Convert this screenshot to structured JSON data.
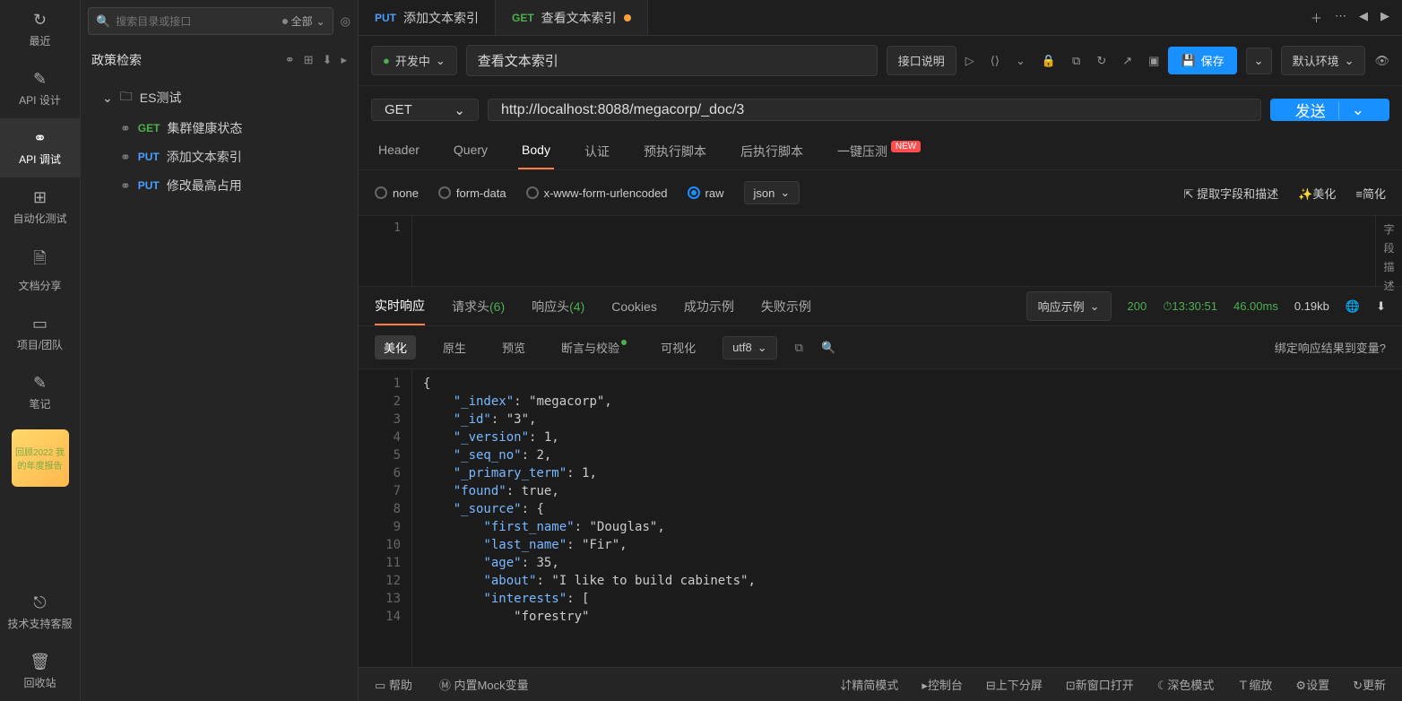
{
  "leftbar": {
    "items": [
      {
        "label": "最近",
        "icon": "↻"
      },
      {
        "label": "API 设计",
        "icon": "✎"
      },
      {
        "label": "API 调试",
        "icon": "⚭"
      },
      {
        "label": "自动化测试",
        "icon": "⊞"
      },
      {
        "label": "文档分享",
        "icon": "🗎"
      },
      {
        "label": "项目/团队",
        "icon": "▭"
      },
      {
        "label": "笔记",
        "icon": "✎"
      }
    ],
    "promo": "回顾2022 我的年度报告",
    "support": "技术支持客服",
    "trash": "回收站"
  },
  "sidepanel": {
    "search_placeholder": "搜索目录或接口",
    "scope": "全部",
    "title": "政策检索",
    "folder": "ES测试",
    "items": [
      {
        "method": "GET",
        "label": "集群健康状态"
      },
      {
        "method": "PUT",
        "label": "添加文本索引"
      },
      {
        "method": "PUT",
        "label": "修改最高占用"
      }
    ]
  },
  "tabs": [
    {
      "method": "PUT",
      "label": "添加文本索引",
      "active": false
    },
    {
      "method": "GET",
      "label": "查看文本索引",
      "active": true,
      "dirty": true
    }
  ],
  "meta": {
    "status": "开发中",
    "name": "查看文本索引",
    "spec": "接口说明",
    "save": "保存",
    "env": "默认环境"
  },
  "request": {
    "method": "GET",
    "url": "http://localhost:8088/megacorp/_doc/3",
    "send": "发送"
  },
  "subtabs": [
    "Header",
    "Query",
    "Body",
    "认证",
    "预执行脚本",
    "后执行脚本",
    "一键压测"
  ],
  "subtab_badge": "NEW",
  "body": {
    "radios": [
      "none",
      "form-data",
      "x-www-form-urlencoded",
      "raw"
    ],
    "type": "json",
    "extract": "提取字段和描述",
    "beautify": "美化",
    "simplify": "简化",
    "vstrip": "字段描述"
  },
  "resp_tabs": {
    "items": [
      "实时响应",
      "请求头",
      "响应头",
      "Cookies",
      "成功示例",
      "失败示例"
    ],
    "req_count": "(6)",
    "res_count": "(4)",
    "example": "响应示例",
    "status": "200",
    "time": "13:30:51",
    "dur": "46.00ms",
    "size": "0.19kb"
  },
  "view": {
    "opts": [
      "美化",
      "原生",
      "预览",
      "断言与校验",
      "可视化"
    ],
    "enc": "utf8",
    "bind": "绑定响应结果到变量?"
  },
  "json_lines": [
    "{",
    "    \"_index\": \"megacorp\",",
    "    \"_id\": \"3\",",
    "    \"_version\": 1,",
    "    \"_seq_no\": 2,",
    "    \"_primary_term\": 1,",
    "    \"found\": true,",
    "    \"_source\": {",
    "        \"first_name\": \"Douglas\",",
    "        \"last_name\": \"Fir\",",
    "        \"age\": 35,",
    "        \"about\": \"I like to build cabinets\",",
    "        \"interests\": [",
    "            \"forestry\""
  ],
  "bottom": {
    "help": "帮助",
    "mock": "内置Mock变量",
    "compact": "精简模式",
    "console": "控制台",
    "split": "上下分屏",
    "newwin": "新窗口打开",
    "dark": "深色模式",
    "zoom": "缩放",
    "settings": "设置",
    "refresh": "更新"
  }
}
